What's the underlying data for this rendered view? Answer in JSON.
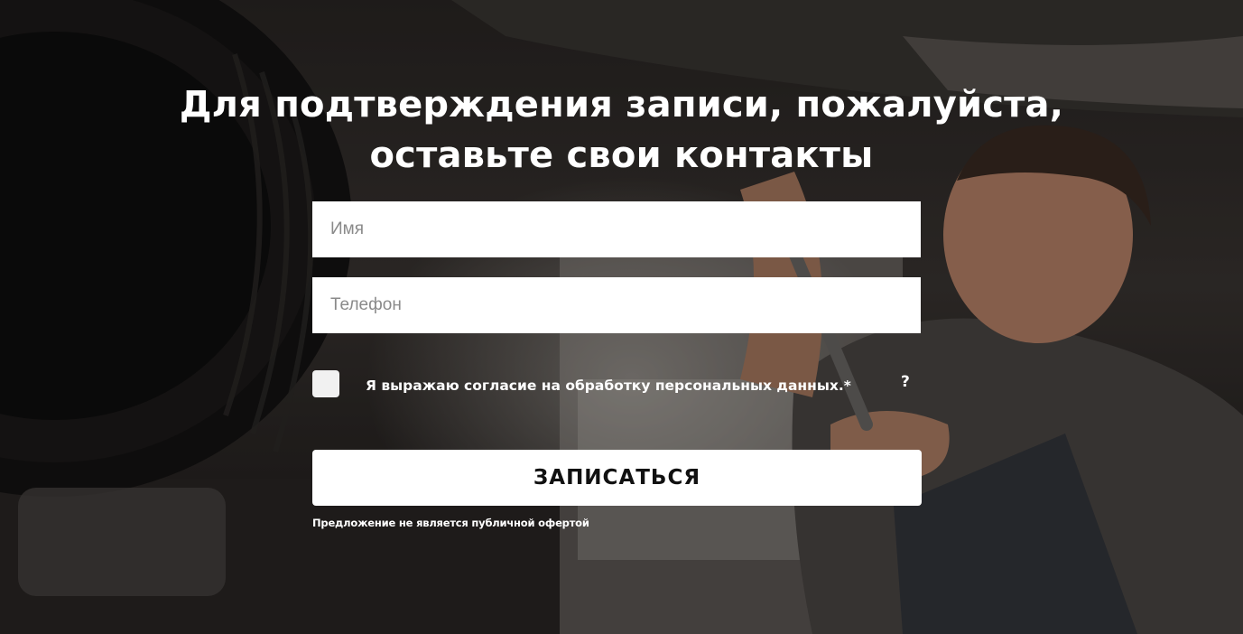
{
  "form": {
    "title_line1": "Для подтверждения записи, пожалуйста,",
    "title_line2": "оставьте свои контакты",
    "name_placeholder": "Имя",
    "phone_placeholder": "Телефон",
    "consent_label": "Я выражаю согласие на обработку персональных данных.*",
    "consent_checked": false,
    "help_label": "?",
    "submit_label": "ЗАПИСАТЬСЯ",
    "disclaimer": "Предложение не является публичной офертой"
  },
  "colors": {
    "text": "#ffffff",
    "field_bg": "#ffffff",
    "button_bg": "#ffffff",
    "button_text": "#111111"
  }
}
